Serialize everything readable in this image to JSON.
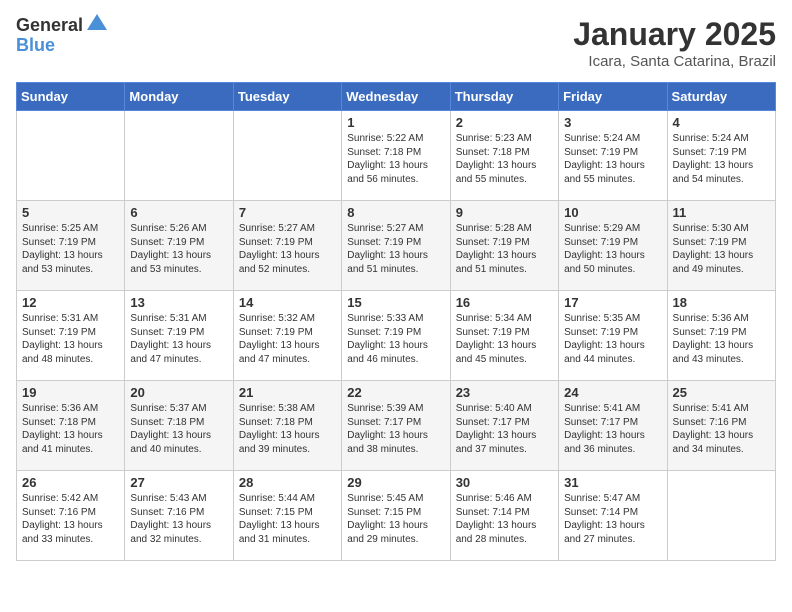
{
  "header": {
    "logo_general": "General",
    "logo_blue": "Blue",
    "month_year": "January 2025",
    "location": "Icara, Santa Catarina, Brazil"
  },
  "days_of_week": [
    "Sunday",
    "Monday",
    "Tuesday",
    "Wednesday",
    "Thursday",
    "Friday",
    "Saturday"
  ],
  "weeks": [
    [
      {
        "day": "",
        "text": ""
      },
      {
        "day": "",
        "text": ""
      },
      {
        "day": "",
        "text": ""
      },
      {
        "day": "1",
        "text": "Sunrise: 5:22 AM\nSunset: 7:18 PM\nDaylight: 13 hours\nand 56 minutes."
      },
      {
        "day": "2",
        "text": "Sunrise: 5:23 AM\nSunset: 7:18 PM\nDaylight: 13 hours\nand 55 minutes."
      },
      {
        "day": "3",
        "text": "Sunrise: 5:24 AM\nSunset: 7:19 PM\nDaylight: 13 hours\nand 55 minutes."
      },
      {
        "day": "4",
        "text": "Sunrise: 5:24 AM\nSunset: 7:19 PM\nDaylight: 13 hours\nand 54 minutes."
      }
    ],
    [
      {
        "day": "5",
        "text": "Sunrise: 5:25 AM\nSunset: 7:19 PM\nDaylight: 13 hours\nand 53 minutes."
      },
      {
        "day": "6",
        "text": "Sunrise: 5:26 AM\nSunset: 7:19 PM\nDaylight: 13 hours\nand 53 minutes."
      },
      {
        "day": "7",
        "text": "Sunrise: 5:27 AM\nSunset: 7:19 PM\nDaylight: 13 hours\nand 52 minutes."
      },
      {
        "day": "8",
        "text": "Sunrise: 5:27 AM\nSunset: 7:19 PM\nDaylight: 13 hours\nand 51 minutes."
      },
      {
        "day": "9",
        "text": "Sunrise: 5:28 AM\nSunset: 7:19 PM\nDaylight: 13 hours\nand 51 minutes."
      },
      {
        "day": "10",
        "text": "Sunrise: 5:29 AM\nSunset: 7:19 PM\nDaylight: 13 hours\nand 50 minutes."
      },
      {
        "day": "11",
        "text": "Sunrise: 5:30 AM\nSunset: 7:19 PM\nDaylight: 13 hours\nand 49 minutes."
      }
    ],
    [
      {
        "day": "12",
        "text": "Sunrise: 5:31 AM\nSunset: 7:19 PM\nDaylight: 13 hours\nand 48 minutes."
      },
      {
        "day": "13",
        "text": "Sunrise: 5:31 AM\nSunset: 7:19 PM\nDaylight: 13 hours\nand 47 minutes."
      },
      {
        "day": "14",
        "text": "Sunrise: 5:32 AM\nSunset: 7:19 PM\nDaylight: 13 hours\nand 47 minutes."
      },
      {
        "day": "15",
        "text": "Sunrise: 5:33 AM\nSunset: 7:19 PM\nDaylight: 13 hours\nand 46 minutes."
      },
      {
        "day": "16",
        "text": "Sunrise: 5:34 AM\nSunset: 7:19 PM\nDaylight: 13 hours\nand 45 minutes."
      },
      {
        "day": "17",
        "text": "Sunrise: 5:35 AM\nSunset: 7:19 PM\nDaylight: 13 hours\nand 44 minutes."
      },
      {
        "day": "18",
        "text": "Sunrise: 5:36 AM\nSunset: 7:19 PM\nDaylight: 13 hours\nand 43 minutes."
      }
    ],
    [
      {
        "day": "19",
        "text": "Sunrise: 5:36 AM\nSunset: 7:18 PM\nDaylight: 13 hours\nand 41 minutes."
      },
      {
        "day": "20",
        "text": "Sunrise: 5:37 AM\nSunset: 7:18 PM\nDaylight: 13 hours\nand 40 minutes."
      },
      {
        "day": "21",
        "text": "Sunrise: 5:38 AM\nSunset: 7:18 PM\nDaylight: 13 hours\nand 39 minutes."
      },
      {
        "day": "22",
        "text": "Sunrise: 5:39 AM\nSunset: 7:17 PM\nDaylight: 13 hours\nand 38 minutes."
      },
      {
        "day": "23",
        "text": "Sunrise: 5:40 AM\nSunset: 7:17 PM\nDaylight: 13 hours\nand 37 minutes."
      },
      {
        "day": "24",
        "text": "Sunrise: 5:41 AM\nSunset: 7:17 PM\nDaylight: 13 hours\nand 36 minutes."
      },
      {
        "day": "25",
        "text": "Sunrise: 5:41 AM\nSunset: 7:16 PM\nDaylight: 13 hours\nand 34 minutes."
      }
    ],
    [
      {
        "day": "26",
        "text": "Sunrise: 5:42 AM\nSunset: 7:16 PM\nDaylight: 13 hours\nand 33 minutes."
      },
      {
        "day": "27",
        "text": "Sunrise: 5:43 AM\nSunset: 7:16 PM\nDaylight: 13 hours\nand 32 minutes."
      },
      {
        "day": "28",
        "text": "Sunrise: 5:44 AM\nSunset: 7:15 PM\nDaylight: 13 hours\nand 31 minutes."
      },
      {
        "day": "29",
        "text": "Sunrise: 5:45 AM\nSunset: 7:15 PM\nDaylight: 13 hours\nand 29 minutes."
      },
      {
        "day": "30",
        "text": "Sunrise: 5:46 AM\nSunset: 7:14 PM\nDaylight: 13 hours\nand 28 minutes."
      },
      {
        "day": "31",
        "text": "Sunrise: 5:47 AM\nSunset: 7:14 PM\nDaylight: 13 hours\nand 27 minutes."
      },
      {
        "day": "",
        "text": ""
      }
    ]
  ]
}
